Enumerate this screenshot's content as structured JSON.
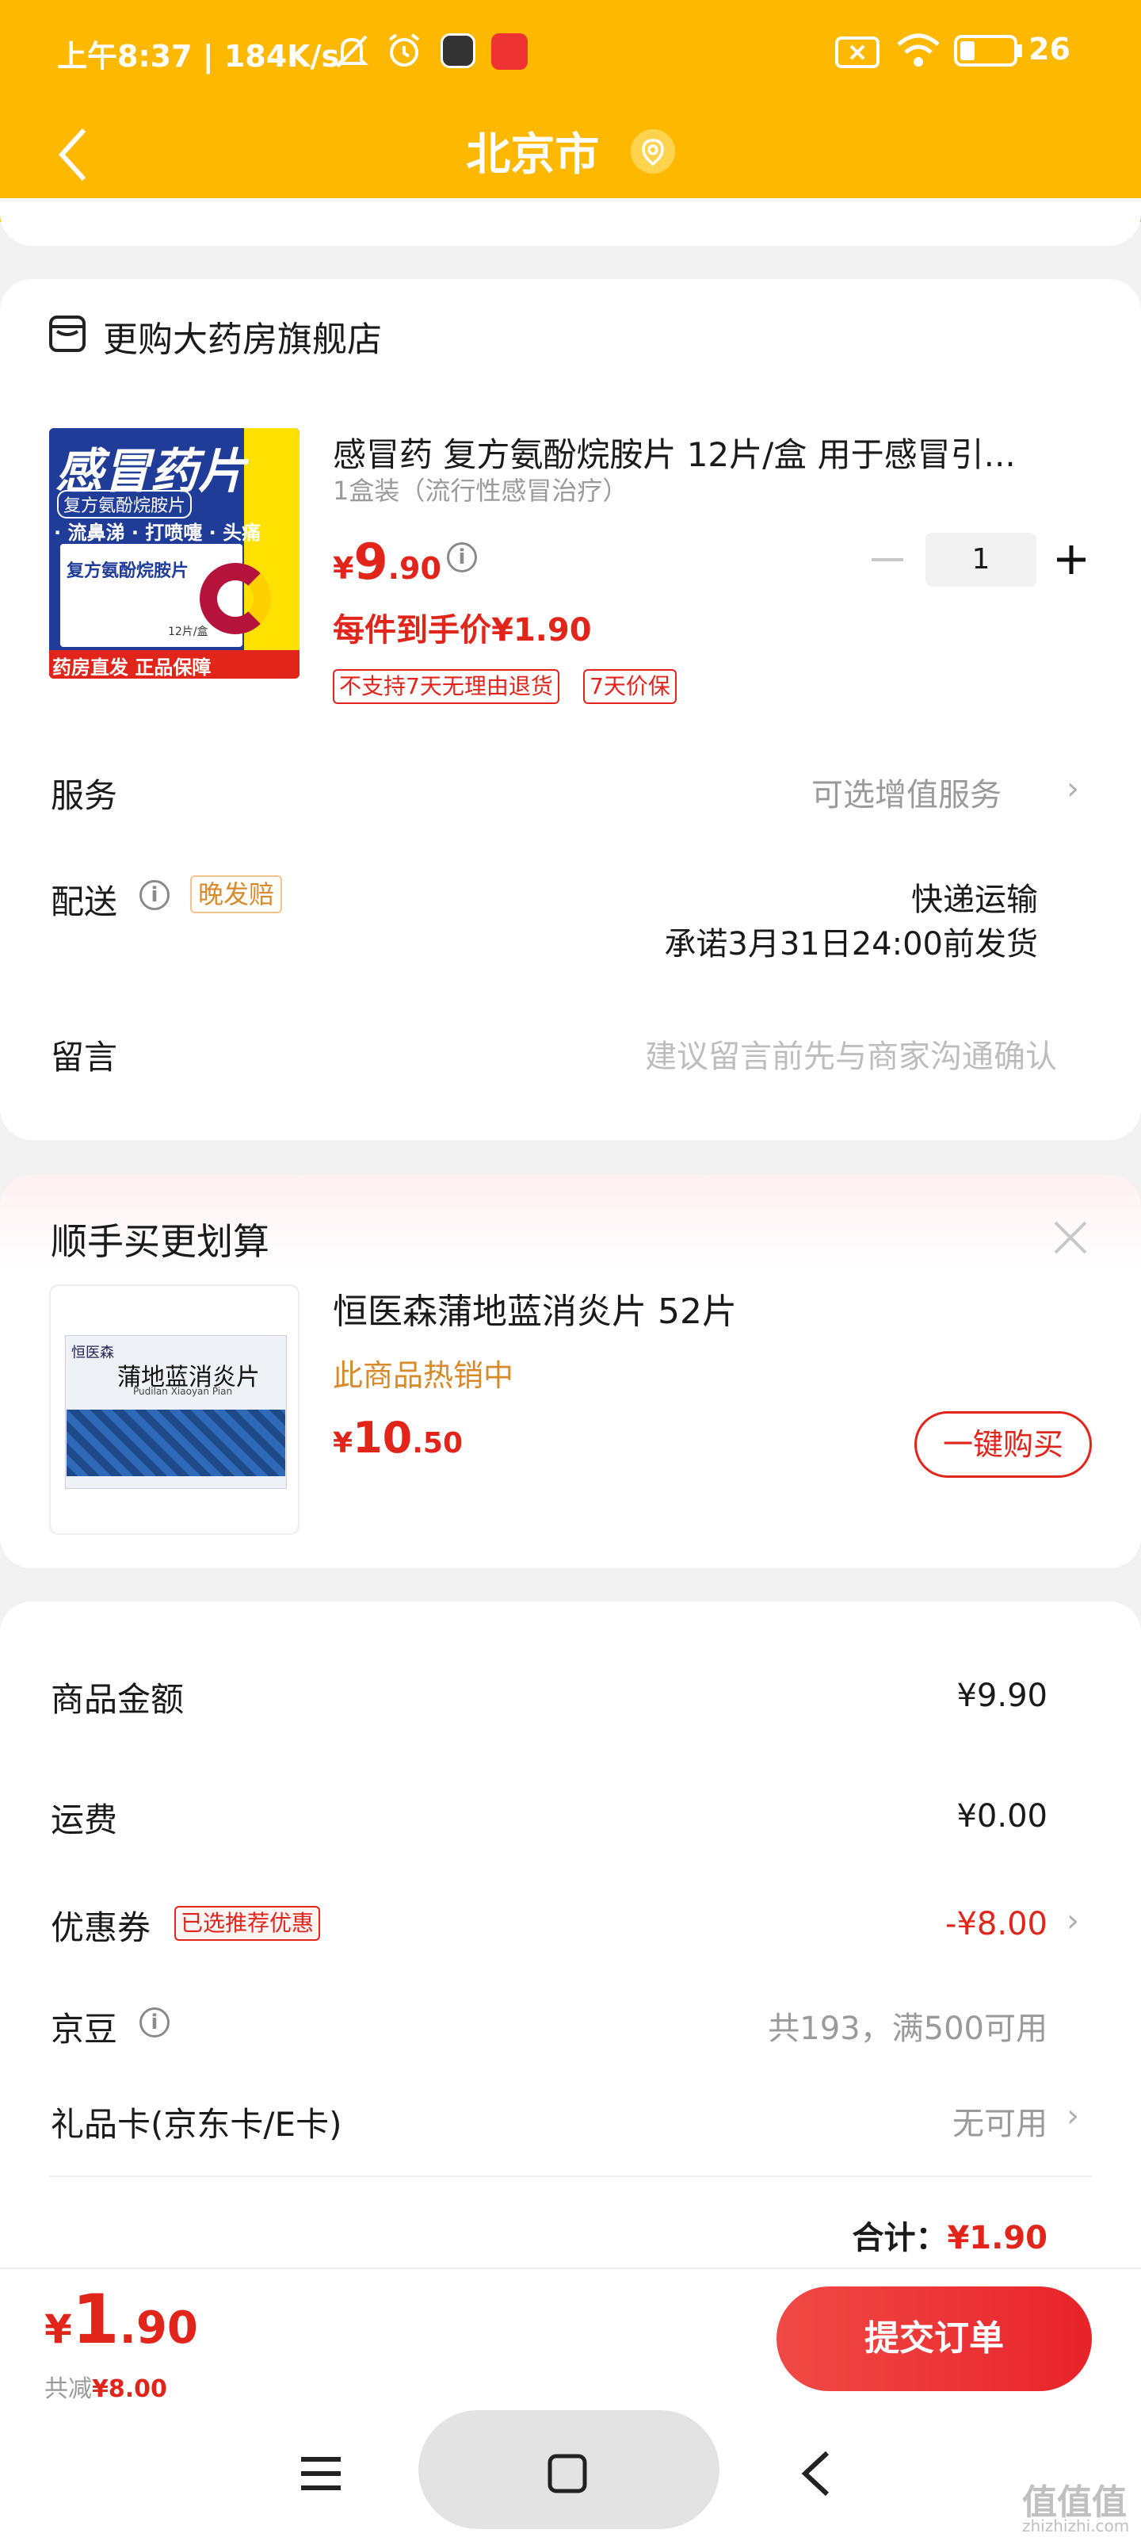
{
  "status_bar": {
    "time_speed": "上午8:37 | 184K/s",
    "battery": "26"
  },
  "header": {
    "title": "北京市"
  },
  "shop": {
    "name": "更购大药房旗舰店"
  },
  "product": {
    "title": "感冒药 复方氨酚烷胺片 12片/盒 用于感冒引...",
    "spec": "1盒装（流行性感冒治疗）",
    "price_symbol": "¥",
    "price_int": "9",
    "price_dec": ".90",
    "quantity": "1",
    "final_price": "每件到手价¥1.90",
    "tags": [
      "不支持7天无理由退货",
      "7天价保"
    ],
    "image": {
      "line1": "感冒药片",
      "line2": "复方氨酚烷胺片",
      "line3": "· 流鼻涕 · 打喷嚏 · 头痛",
      "box_name": "复方氨酚烷胺片",
      "count": "12片/盒",
      "footer": "药房直发 正品保障"
    }
  },
  "rows": {
    "service_label": "服务",
    "service_value": "可选增值服务",
    "delivery_label": "配送",
    "delivery_badge": "晚发赔",
    "delivery_method": "快递运输",
    "delivery_promise": "承诺3月31日24:00前发货",
    "message_label": "留言",
    "message_placeholder": "建议留言前先与商家沟通确认"
  },
  "upsell": {
    "title": "顺手买更划算",
    "product_name": "恒医森蒲地蓝消炎片 52片",
    "hot_text": "此商品热销中",
    "price_symbol": "¥",
    "price_int": "10",
    "price_dec": ".50",
    "buy_button": "一键购买",
    "image": {
      "brand": "恒医森",
      "name": "蒲地蓝消炎片",
      "pinyin": "Pudilan Xiaoyan Pian"
    }
  },
  "summary": {
    "goods_label": "商品金额",
    "goods_value": "¥9.90",
    "shipping_label": "运费",
    "shipping_value": "¥0.00",
    "coupon_label": "优惠券",
    "coupon_badge": "已选推荐优惠",
    "coupon_value": "-¥8.00",
    "jingdou_label": "京豆",
    "jingdou_value": "共193，满500可用",
    "giftcard_label": "礼品卡(京东卡/E卡)",
    "giftcard_value": "无可用",
    "total_label": "合计：",
    "total_value": "¥1.90"
  },
  "bottom": {
    "price_symbol": "¥",
    "price_int": "1",
    "price_dec": ".90",
    "saving_label": "共减",
    "saving_value": "¥8.00",
    "submit": "提交订单"
  },
  "watermark": {
    "text": "值值值",
    "url": "zhizhizhi.com"
  }
}
